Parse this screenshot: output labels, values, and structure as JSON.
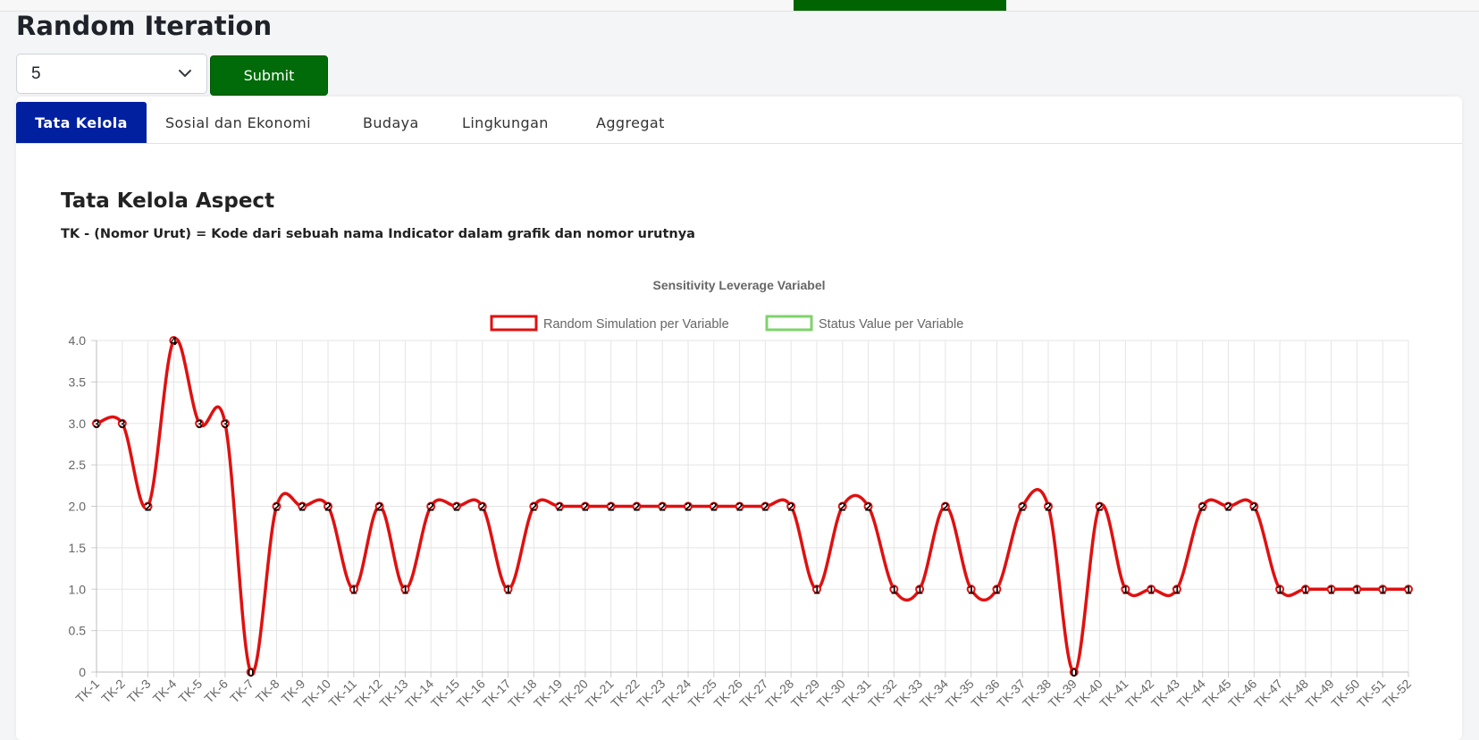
{
  "page": {
    "title": "Random Iteration"
  },
  "controls": {
    "iteration_value": "5",
    "submit_label": "Submit"
  },
  "tabs": [
    {
      "label": "Tata Kelola",
      "active": true
    },
    {
      "label": "Sosial dan Ekonomi",
      "active": false
    },
    {
      "label": "Budaya",
      "active": false
    },
    {
      "label": "Lingkungan",
      "active": false
    },
    {
      "label": "Aggregat",
      "active": false
    }
  ],
  "section": {
    "title": "Tata Kelola Aspect",
    "note": "TK - (Nomor Urut) = Kode dari sebuah nama Indicator dalam grafik dan nomor urutnya"
  },
  "colors": {
    "accent_green": "#016b09",
    "tab_active": "#0020a0",
    "series_random": "#e01010",
    "series_status": "#7fd36b"
  },
  "chart_data": {
    "type": "line",
    "title": "Sensitivity Leverage Variabel",
    "categories": [
      "TK-1",
      "TK-2",
      "TK-3",
      "TK-4",
      "TK-5",
      "TK-6",
      "TK-7",
      "TK-8",
      "TK-9",
      "TK-10",
      "TK-11",
      "TK-12",
      "TK-13",
      "TK-14",
      "TK-15",
      "TK-16",
      "TK-17",
      "TK-18",
      "TK-19",
      "TK-20",
      "TK-21",
      "TK-22",
      "TK-23",
      "TK-24",
      "TK-25",
      "TK-26",
      "TK-27",
      "TK-28",
      "TK-29",
      "TK-30",
      "TK-31",
      "TK-32",
      "TK-33",
      "TK-34",
      "TK-35",
      "TK-36",
      "TK-37",
      "TK-38",
      "TK-39",
      "TK-40",
      "TK-41",
      "TK-42",
      "TK-43",
      "TK-44",
      "TK-45",
      "TK-46",
      "TK-47",
      "TK-48",
      "TK-49",
      "TK-50",
      "TK-51",
      "TK-52"
    ],
    "series": [
      {
        "name": "Random Simulation per Variable",
        "color": "#e01010",
        "values": [
          3,
          3,
          2,
          4,
          3,
          3,
          0,
          2,
          2,
          2,
          1,
          2,
          1,
          2,
          2,
          2,
          1,
          2,
          2,
          2,
          2,
          2,
          2,
          2,
          2,
          2,
          2,
          2,
          1,
          2,
          2,
          1,
          1,
          2,
          1,
          1,
          2,
          2,
          0,
          2,
          1,
          1,
          1,
          2,
          2,
          2,
          1,
          1,
          1,
          1,
          1,
          1
        ]
      },
      {
        "name": "Status Value per Variable",
        "color": "#7fd36b",
        "values": []
      }
    ],
    "yticks": [
      "0",
      "0.5",
      "1.0",
      "1.5",
      "2.0",
      "2.5",
      "3.0",
      "3.5",
      "4.0"
    ],
    "ylim": [
      0,
      4
    ],
    "legend": "top-center",
    "grid": true
  }
}
